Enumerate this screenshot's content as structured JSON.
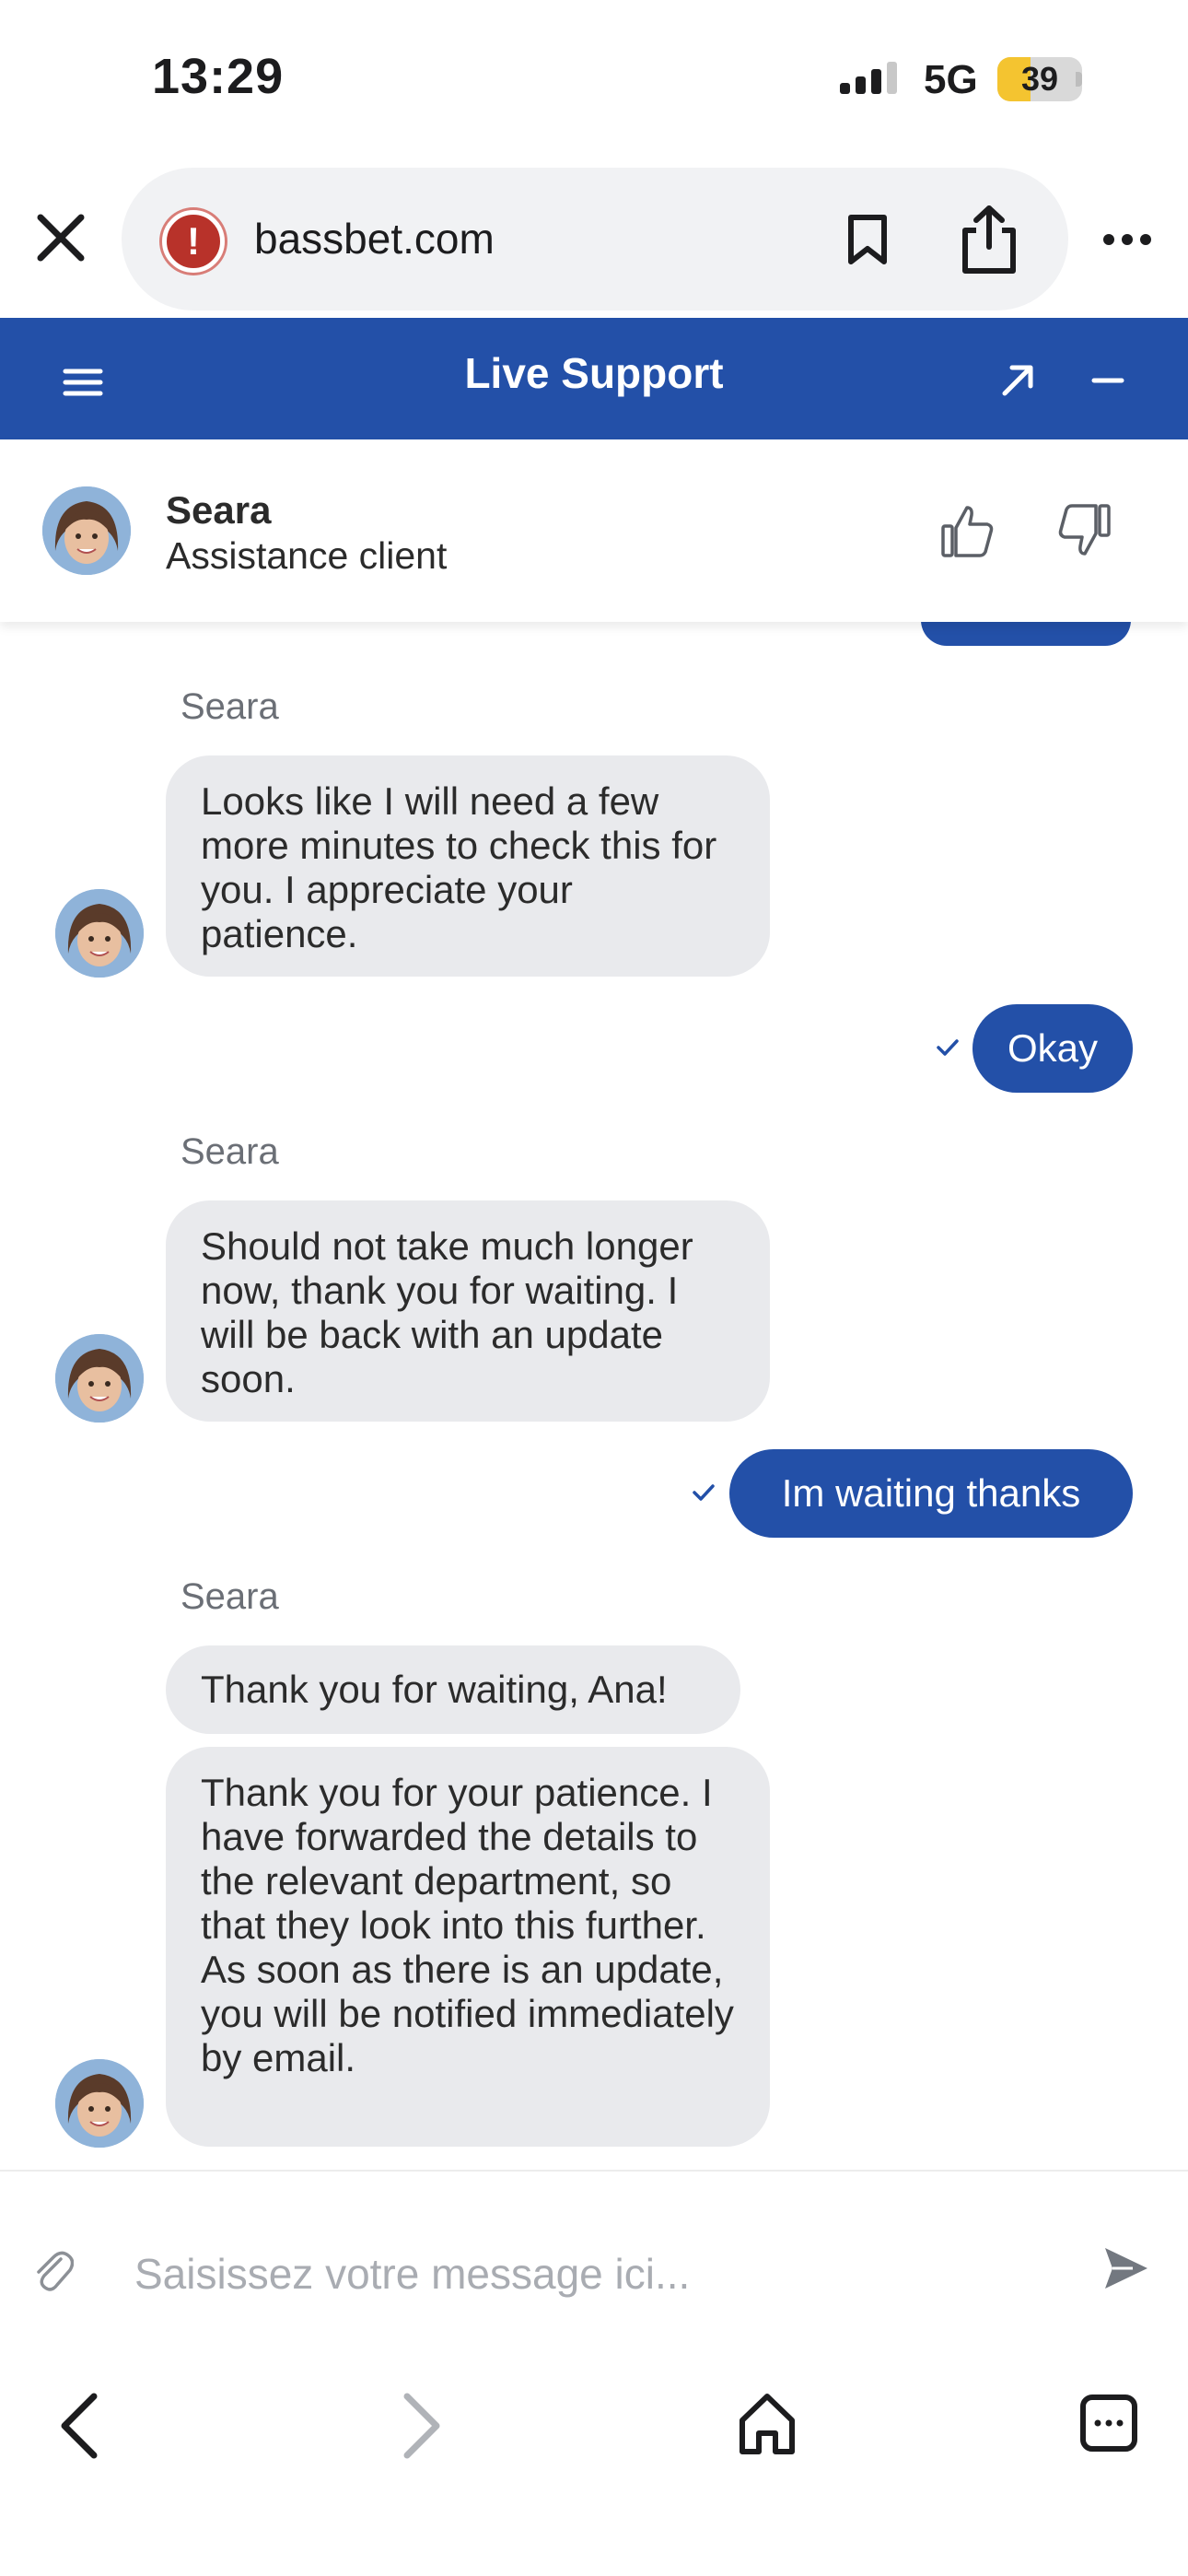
{
  "status_bar": {
    "time": "13:29",
    "network": "5G",
    "battery": "39",
    "battery_fraction": 0.39
  },
  "browser": {
    "url": "bassbet.com"
  },
  "chat": {
    "title": "Live Support",
    "agent": {
      "name": "Seara",
      "role": "Assistance client"
    }
  },
  "messages": [
    {
      "from": "agent",
      "sender": "Seara",
      "text": "Looks like I will need a few more minutes to check this for you. I appreciate your patience."
    },
    {
      "from": "user",
      "text": "Okay"
    },
    {
      "from": "agent",
      "sender": "Seara",
      "text": "Should not take much longer now, thank you for waiting. I will be back with an update soon."
    },
    {
      "from": "user",
      "text": "Im waiting thanks"
    },
    {
      "from": "agent",
      "sender": "Seara",
      "text": "Thank you for waiting, Ana!"
    },
    {
      "from": "agent",
      "sender": "",
      "text": "Thank you for your patience. I have forwarded the details to the relevant department, so that they look into this further. As soon as there is an update, you will be notified immediately by email."
    }
  ],
  "composer": {
    "placeholder": "Saisissez votre message ici..."
  },
  "colors": {
    "brand": "#2350a8",
    "incoming_bubble": "#e9eaed",
    "warning": "#b8322a",
    "battery": "#f4c430"
  },
  "icons": [
    "close-icon",
    "security-warning-icon",
    "bookmark-icon",
    "share-icon",
    "more-icon",
    "menu-icon",
    "expand-icon",
    "minimize-icon",
    "thumbs-up-icon",
    "thumbs-down-icon",
    "attach-icon",
    "send-icon",
    "back-icon",
    "forward-icon",
    "home-icon",
    "tabs-icon"
  ]
}
